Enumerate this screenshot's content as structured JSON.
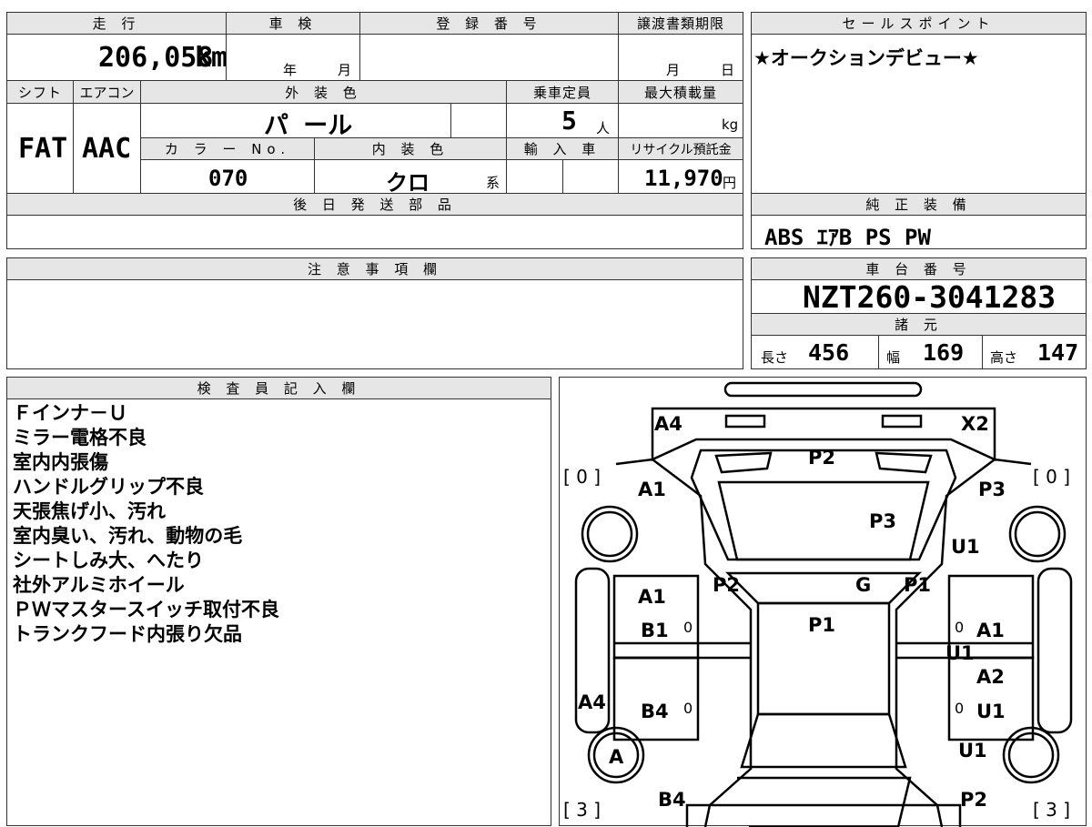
{
  "top_section": {
    "mileage": {
      "label": "走 行",
      "value": "206,058",
      "unit": "km"
    },
    "shaken": {
      "label": "車 検",
      "year_unit": "年",
      "month_unit": "月"
    },
    "registration": {
      "label": "登 録 番 号"
    },
    "transfer_deadline": {
      "label": "譲渡書類期限",
      "month_unit": "月",
      "day_unit": "日"
    },
    "shift": {
      "label": "シフト",
      "value": "FAT"
    },
    "aircon": {
      "label": "エアコン",
      "value": "AAC"
    },
    "exterior_color": {
      "label": "外 装 色",
      "value": "パ ール"
    },
    "capacity": {
      "label": "乗車定員",
      "value": "5",
      "unit": "人"
    },
    "max_load": {
      "label": "最大積載量",
      "unit": "kg"
    },
    "color_no": {
      "label": "カ ラ ー No.",
      "value": "070"
    },
    "interior_color": {
      "label": "内 装 色",
      "value": "クロ",
      "suffix": "系"
    },
    "import": {
      "label": "輸 入 車"
    },
    "recycle_fee": {
      "label": "リサイクル預託金",
      "value": "11,970",
      "unit": "円"
    },
    "later_parts": {
      "label": "後 日 発 送 部 品"
    }
  },
  "sales_point": {
    "label": "セールスポイント",
    "text": "★オークションデビュー★"
  },
  "equipment": {
    "label": "純 正 装 備",
    "text": "ABS ｴｱB PS PW"
  },
  "caution": {
    "label": "注 意 事 項 欄"
  },
  "chassis": {
    "label": "車 台 番 号",
    "value": "NZT260-3041283"
  },
  "specs": {
    "label": "諸 元",
    "length": {
      "label": "長さ",
      "value": "456"
    },
    "width": {
      "label": "幅",
      "value": "169"
    },
    "height": {
      "label": "高さ",
      "value": "147"
    }
  },
  "inspector": {
    "label": "検 査 員 記 入 欄",
    "notes": [
      "Ｆインナ－Ｕ",
      "ミラー電格不良",
      "室内内張傷",
      "ハンドルグリップ不良",
      "天張焦げ小、汚れ",
      "室内臭い、汚れ、動物の毛",
      "シートしみ大、へたり",
      "社外アルミホイール",
      "ＰＷマスタースイッチ取付不良",
      "トランクフード内張り欠品"
    ]
  },
  "diagram": {
    "tire_fl": "[ 0 ]",
    "tire_fr": "[ 0 ]",
    "tire_rl": "[ 3 ]",
    "tire_rr": "[ 3 ]",
    "marks": {
      "front_bumper_left": "A4",
      "front_bumper_right": "X2",
      "hood_front": "P2",
      "fender_fl": "A1",
      "fender_fr": "P3",
      "hood": "P3",
      "fender_fr2": "U1",
      "pillar_l": "P2",
      "windshield": "G",
      "pillar_r": "P1",
      "roof": "P1",
      "door_fl_1": "A1",
      "door_fl_2": "B1",
      "door_fl_zero": "0",
      "door_fr_zero": "0",
      "door_fr_1": "A1",
      "door_fr_2": "U1",
      "door_rr_1": "A2",
      "door_rr_2": "U1",
      "door_rr_zero": "0",
      "sill_l": "A4",
      "door_rl": "B4",
      "door_rl_zero": "0",
      "wheel_rl": "A",
      "qtr_rr": "U1",
      "rear_l": "B4",
      "rear_r": "P2"
    }
  }
}
